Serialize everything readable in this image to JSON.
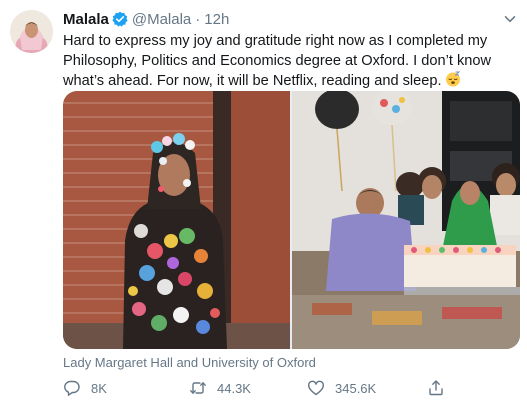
{
  "tweet": {
    "author_name": "Malala",
    "author_handle": "@Malala",
    "separator": "·",
    "timestamp": "12h",
    "text": "Hard to express my joy and gratitude right now as I completed my Philosophy, Politics and Economics degree at Oxford. I don’t know what’s ahead. For now, it will be Netflix, reading and sleep.",
    "emoji_icon": "sleeping-face-emoji",
    "location": "Lady Margaret Hall and University of Oxford"
  },
  "actions": {
    "reply_count": "8K",
    "retweet_count": "44.3K",
    "like_count": "345.6K",
    "icons": [
      "reply-icon",
      "retweet-icon",
      "heart-icon",
      "share-icon"
    ]
  },
  "colors": {
    "verified_blue": "#1da1f2",
    "muted_text": "#657786",
    "primary_text": "#14171a"
  }
}
